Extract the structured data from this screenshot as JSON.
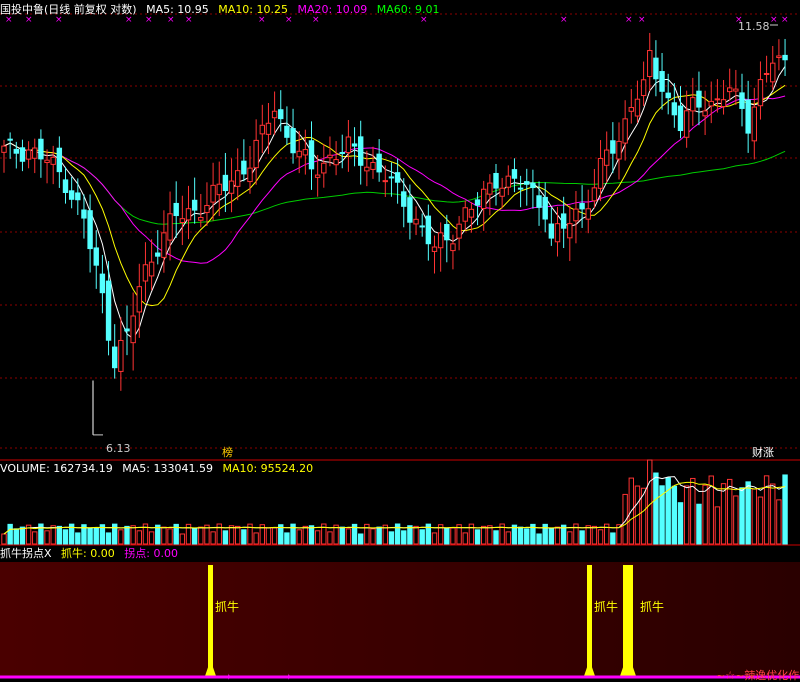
{
  "header": {
    "title": "国投中鲁(日线 前复权 对数)",
    "ma5": "MA5: 10.95",
    "ma10": "MA10: 10.25",
    "ma20": "MA20: 10.09",
    "ma60": "MA60: 9.01"
  },
  "volume_header": {
    "label": "VOLUME: 162734.19",
    "ma5": "MA5: 133041.59",
    "ma10": "MA10: 95524.20"
  },
  "indicator_header": {
    "name": "抓牛拐点X",
    "zhuaniu": "抓牛: 0.00",
    "guaidian": "拐点: 0.00"
  },
  "annotations": {
    "high": "11.58",
    "low": "6.13",
    "tag_left": "榜",
    "tag_right": "财涨",
    "signal_label": "抓牛",
    "watermark": "~☆~辣逸优化作"
  },
  "colors": {
    "up": "#ff3333",
    "down": "#54ffff",
    "ma5": "#ffffff",
    "ma10": "#ffff00",
    "ma20": "#ff00ff",
    "ma60": "#00cc00",
    "signal": "#ffff00",
    "grid": "#8b0000"
  },
  "chart_data": [
    {
      "type": "candlestick",
      "title": "国投中鲁(日线 前复权 对数)",
      "scale": "log",
      "ylim": [
        6.0,
        12.2
      ],
      "high_label": 11.58,
      "low_label": 6.13,
      "series_names": [
        "MA5",
        "MA10",
        "MA20",
        "MA60"
      ],
      "n_bars": 120
    },
    {
      "type": "bar",
      "title": "VOLUME",
      "values_summary": {
        "volume": 162734.19,
        "ma5": 133041.59,
        "ma10": 95524.2
      },
      "n_bars": 120
    },
    {
      "type": "signal",
      "title": "抓牛拐点X",
      "series": [
        {
          "name": "抓牛",
          "value": 0.0
        },
        {
          "name": "拐点",
          "value": 0.0
        }
      ]
    }
  ]
}
